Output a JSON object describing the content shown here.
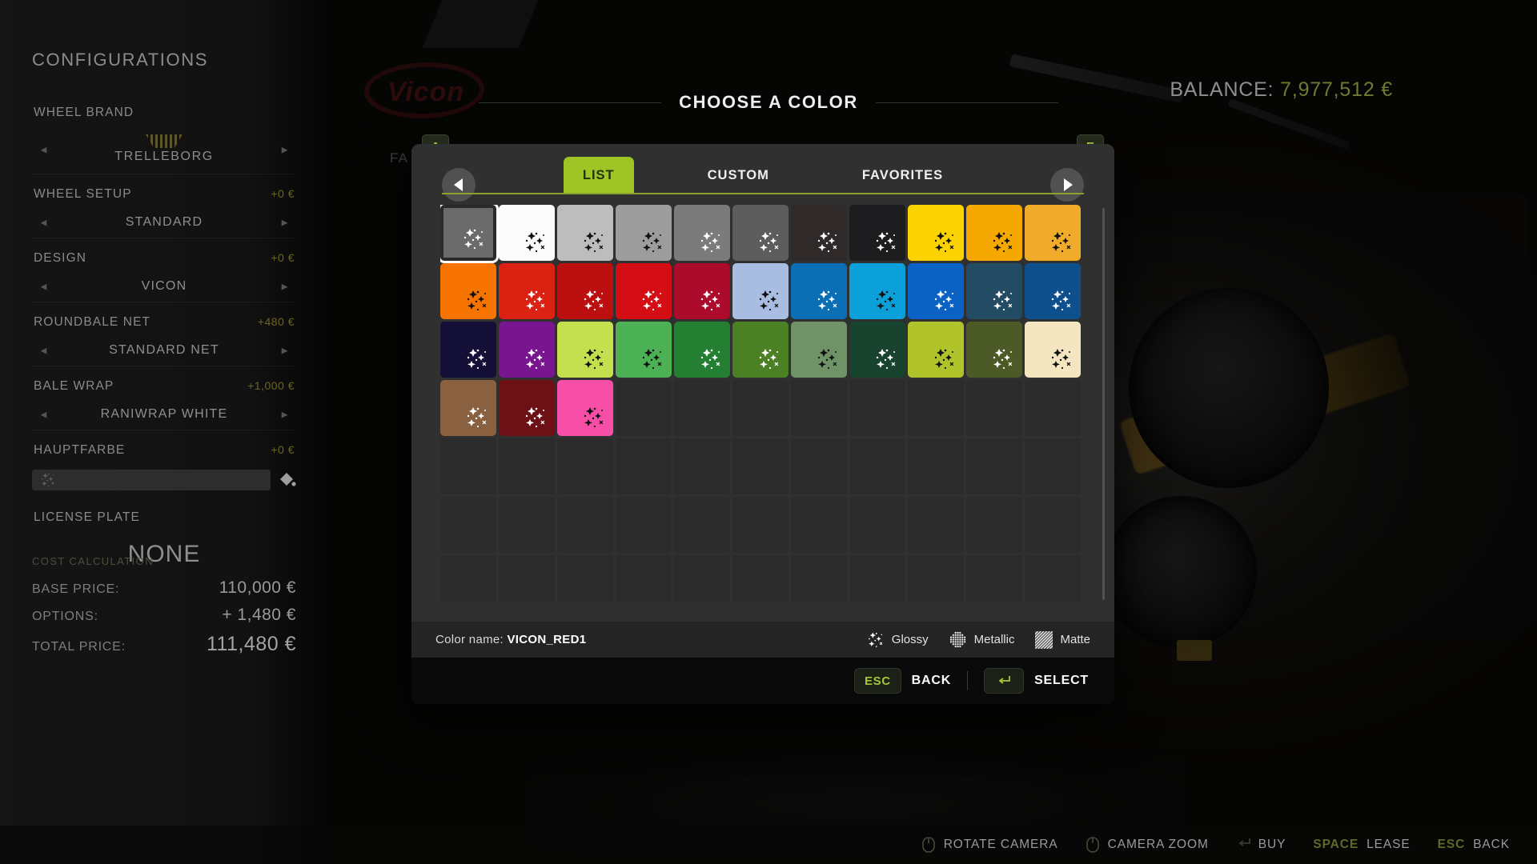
{
  "scene": {
    "brand_logo_text": "Vicon"
  },
  "balance": {
    "label": "BALANCE:",
    "amount": "7,977,512 €"
  },
  "page_title": "CHOOSE A COLOR",
  "behind_text": "FA",
  "sidebar": {
    "title": "CONFIGURATIONS",
    "rows": [
      {
        "label": "WHEEL BRAND",
        "price": "",
        "value": "TRELLEBORG",
        "type": "brand"
      },
      {
        "label": "WHEEL SETUP",
        "price": "+0 €",
        "value": "STANDARD",
        "type": "selector"
      },
      {
        "label": "DESIGN",
        "price": "+0 €",
        "value": "VICON",
        "type": "selector"
      },
      {
        "label": "ROUNDBALE NET",
        "price": "+480 €",
        "value": "STANDARD NET",
        "type": "selector"
      },
      {
        "label": "BALE WRAP",
        "price": "+1,000 €",
        "value": "RANIWRAP WHITE",
        "type": "selector"
      },
      {
        "label": "HAUPTFARBE",
        "price": "+0 €",
        "value": "",
        "type": "colorbar"
      },
      {
        "label": "LICENSE PLATE",
        "price": "",
        "value": "NONE",
        "type": "plain"
      }
    ],
    "arrow_left": "◄",
    "arrow_right": "►",
    "cost": {
      "title": "COST CALCULATION",
      "lines": [
        {
          "label": "BASE PRICE:",
          "value": "110,000 €"
        },
        {
          "label": "OPTIONS:",
          "value": "+ 1,480 €"
        },
        {
          "label": "TOTAL PRICE:",
          "value": "111,480 €"
        }
      ]
    }
  },
  "dialog": {
    "badge_left": "A",
    "badge_right": "E",
    "tabs": [
      {
        "label": "LIST",
        "active": true
      },
      {
        "label": "CUSTOM",
        "active": false
      },
      {
        "label": "FAVORITES",
        "active": false
      }
    ],
    "color_name_label": "Color name:",
    "color_name_value": "VICON_RED1",
    "legend": [
      {
        "label": "Glossy",
        "icon": "glossy-sparkle-icon"
      },
      {
        "label": "Metallic",
        "icon": "metallic-dots-icon"
      },
      {
        "label": "Matte",
        "icon": "matte-hatch-icon"
      }
    ],
    "actions": [
      {
        "key": "ESC",
        "label": "BACK",
        "icon": "esc-key-icon"
      },
      {
        "key": "↵",
        "label": "SELECT",
        "icon": "enter-key-icon"
      }
    ],
    "columns": 11,
    "total_rows": 9,
    "scrollbar_visible": true,
    "selected_index": 0,
    "swatches": [
      {
        "hex": "#6b6b6b",
        "finish": "glossy",
        "mark": "light"
      },
      {
        "hex": "#fbfbfb",
        "finish": "glossy",
        "mark": "dark"
      },
      {
        "hex": "#bdbdbd",
        "finish": "glossy",
        "mark": "dark"
      },
      {
        "hex": "#9d9d9d",
        "finish": "glossy",
        "mark": "dark"
      },
      {
        "hex": "#7b7b7b",
        "finish": "glossy",
        "mark": "light"
      },
      {
        "hex": "#5d5d5d",
        "finish": "glossy",
        "mark": "light"
      },
      {
        "hex": "#30292a",
        "finish": "glossy",
        "mark": "light"
      },
      {
        "hex": "#1d1d1f",
        "finish": "glossy",
        "mark": "light"
      },
      {
        "hex": "#fbd202",
        "finish": "glossy",
        "mark": "dark"
      },
      {
        "hex": "#f5a800",
        "finish": "glossy",
        "mark": "dark"
      },
      {
        "hex": "#f0ab2a",
        "finish": "glossy",
        "mark": "dark"
      },
      {
        "hex": "#f67300",
        "finish": "glossy",
        "mark": "dark"
      },
      {
        "hex": "#da2112",
        "finish": "glossy",
        "mark": "light"
      },
      {
        "hex": "#bc1010",
        "finish": "glossy",
        "mark": "light"
      },
      {
        "hex": "#d50d15",
        "finish": "glossy",
        "mark": "light"
      },
      {
        "hex": "#ac0b2c",
        "finish": "glossy",
        "mark": "light"
      },
      {
        "hex": "#a9bde3",
        "finish": "glossy",
        "mark": "dark"
      },
      {
        "hex": "#0a6fb5",
        "finish": "glossy",
        "mark": "light"
      },
      {
        "hex": "#0ba0d9",
        "finish": "glossy",
        "mark": "dark"
      },
      {
        "hex": "#0a63c4",
        "finish": "glossy",
        "mark": "light"
      },
      {
        "hex": "#234b63",
        "finish": "glossy",
        "mark": "light"
      },
      {
        "hex": "#0e4f8d",
        "finish": "glossy",
        "mark": "light"
      },
      {
        "hex": "#130f36",
        "finish": "glossy",
        "mark": "light"
      },
      {
        "hex": "#7a1590",
        "finish": "glossy",
        "mark": "light"
      },
      {
        "hex": "#c5e04f",
        "finish": "glossy",
        "mark": "dark"
      },
      {
        "hex": "#4cb054",
        "finish": "glossy",
        "mark": "dark"
      },
      {
        "hex": "#247f33",
        "finish": "glossy",
        "mark": "light"
      },
      {
        "hex": "#4b8024",
        "finish": "glossy",
        "mark": "light"
      },
      {
        "hex": "#6f9267",
        "finish": "glossy",
        "mark": "dark"
      },
      {
        "hex": "#17432f",
        "finish": "glossy",
        "mark": "light"
      },
      {
        "hex": "#b1c32a",
        "finish": "glossy",
        "mark": "dark"
      },
      {
        "hex": "#4c5a28",
        "finish": "glossy",
        "mark": "light"
      },
      {
        "hex": "#f4e6c0",
        "finish": "glossy",
        "mark": "dark"
      },
      {
        "hex": "#8a6140",
        "finish": "glossy",
        "mark": "light"
      },
      {
        "hex": "#6d1117",
        "finish": "glossy",
        "mark": "light"
      },
      {
        "hex": "#f74fa8",
        "finish": "glossy",
        "mark": "dark"
      }
    ]
  },
  "helpbar": [
    {
      "type": "icon",
      "icon": "mouse-rotate-icon",
      "label": "ROTATE CAMERA"
    },
    {
      "type": "icon",
      "icon": "mouse-zoom-icon",
      "label": "CAMERA ZOOM"
    },
    {
      "type": "icon",
      "icon": "enter-key-icon",
      "label": "BUY"
    },
    {
      "type": "key",
      "key": "SPACE",
      "label": "LEASE"
    },
    {
      "type": "key",
      "key": "ESC",
      "label": "BACK"
    }
  ]
}
